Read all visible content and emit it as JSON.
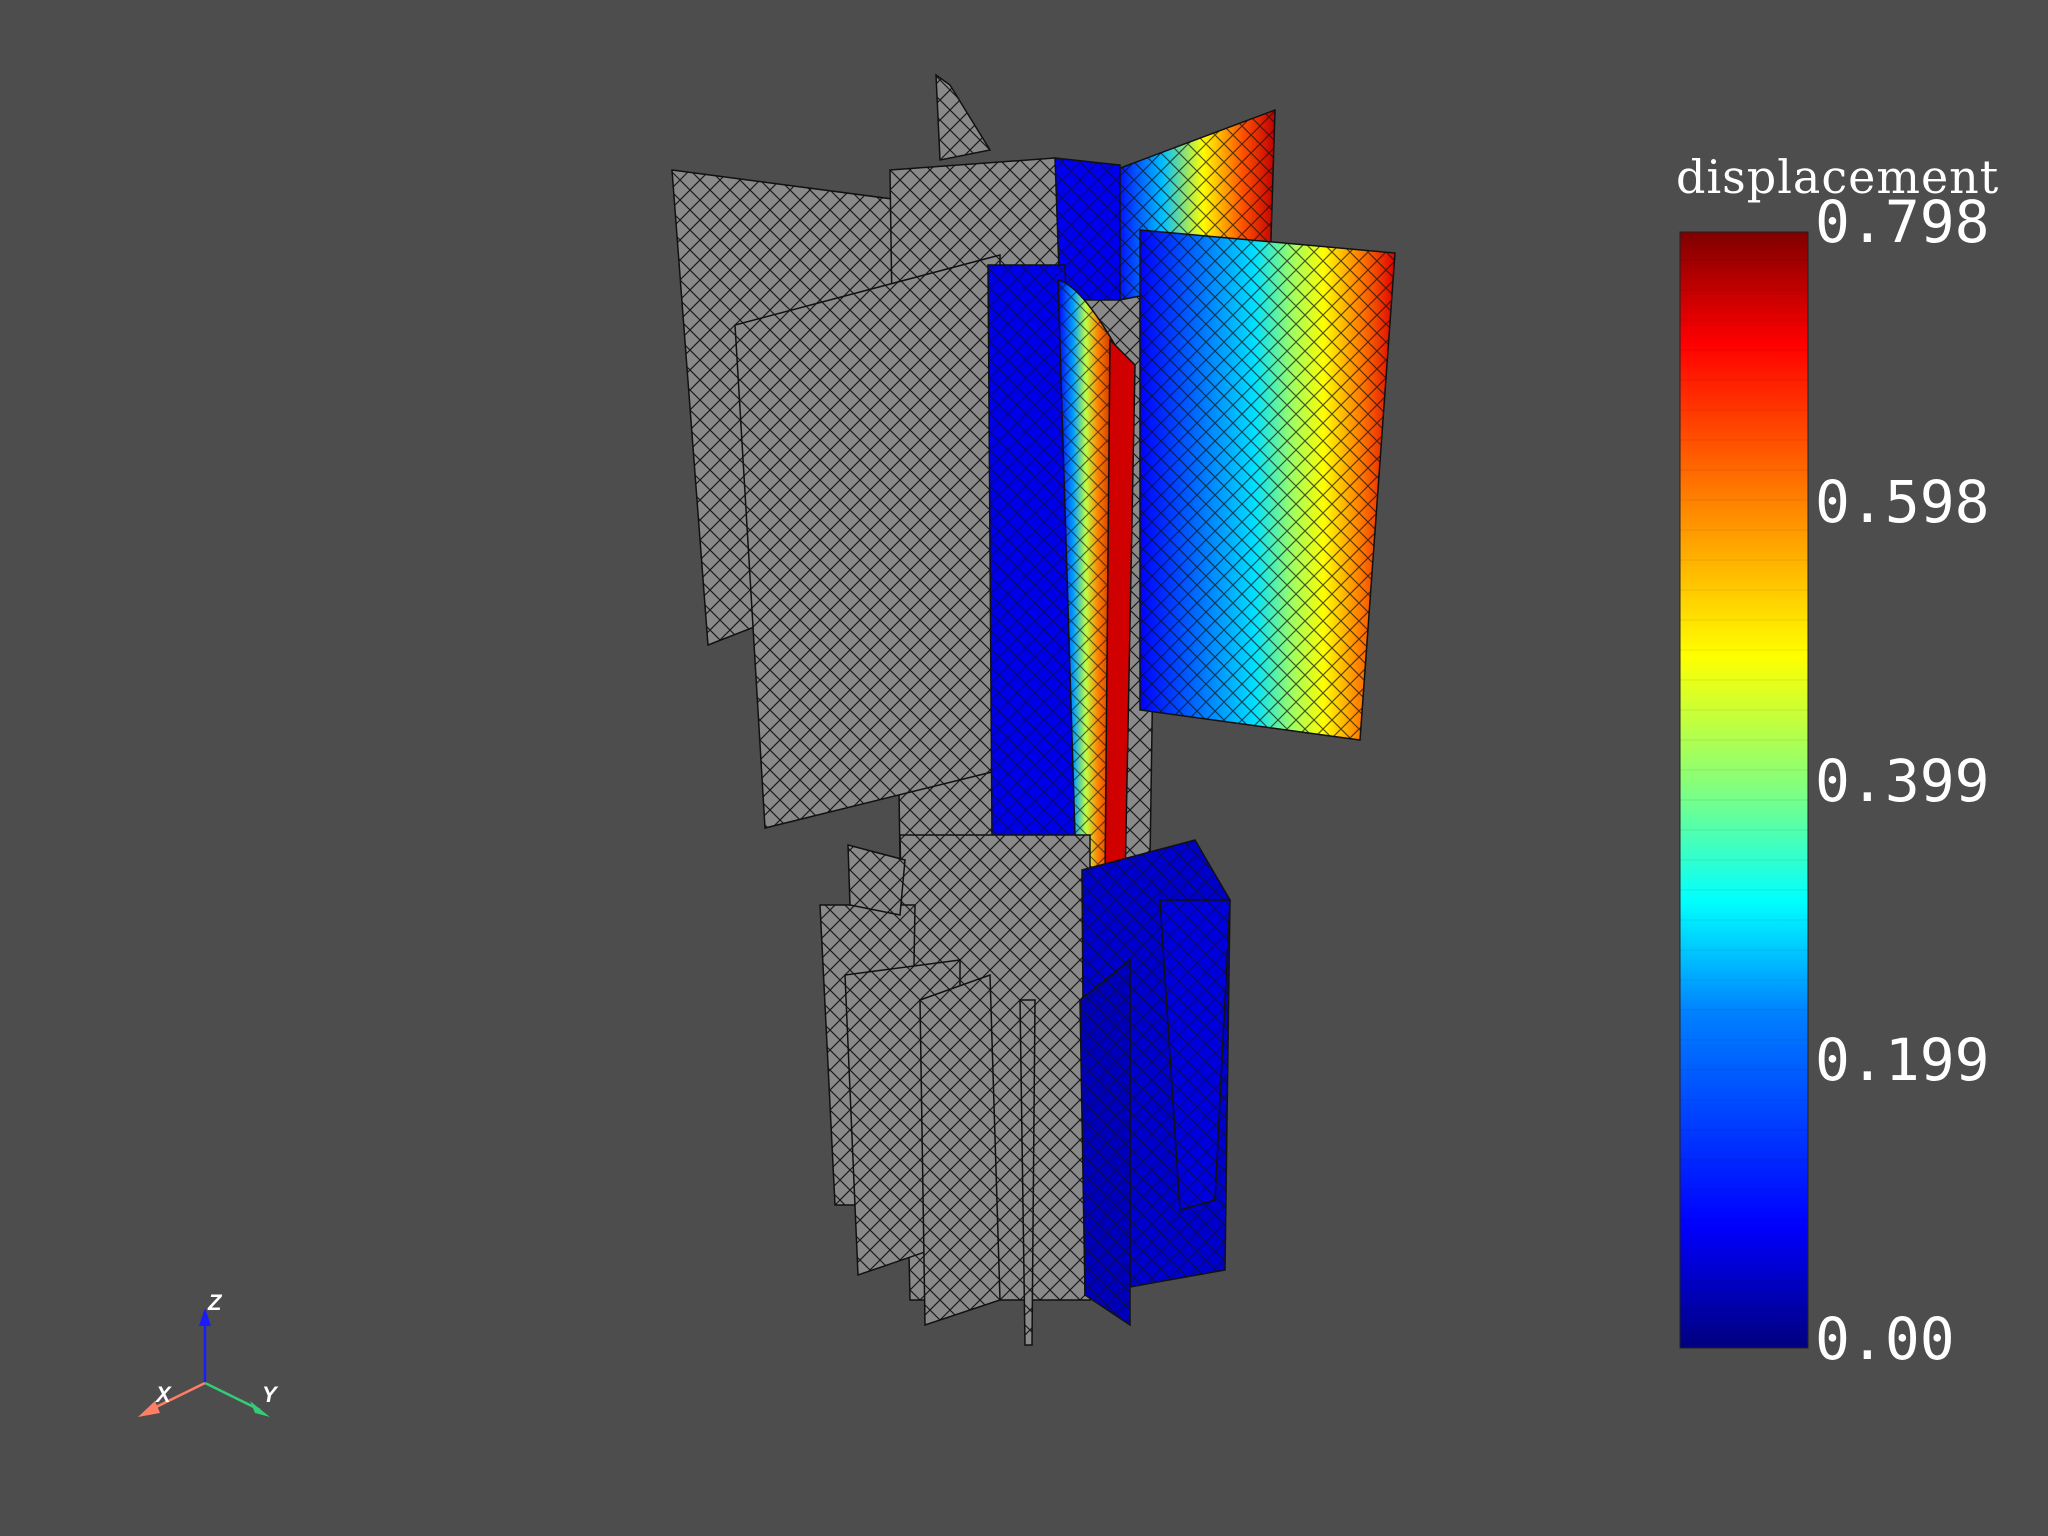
{
  "scalar_bar": {
    "title": "displacement",
    "ticks": [
      "0.798",
      "0.598",
      "0.399",
      "0.199",
      "0.00"
    ],
    "colormap": [
      "#00007f",
      "#0000ff",
      "#0080ff",
      "#00ffff",
      "#80ff80",
      "#ffff00",
      "#ff8000",
      "#ff0000",
      "#7f0000"
    ]
  },
  "axes_widget": {
    "x": "X",
    "y": "Y",
    "z": "Z"
  },
  "colors": {
    "background": "#4d4d4d",
    "mesh_gray": "#808080",
    "edge": "#111111"
  }
}
